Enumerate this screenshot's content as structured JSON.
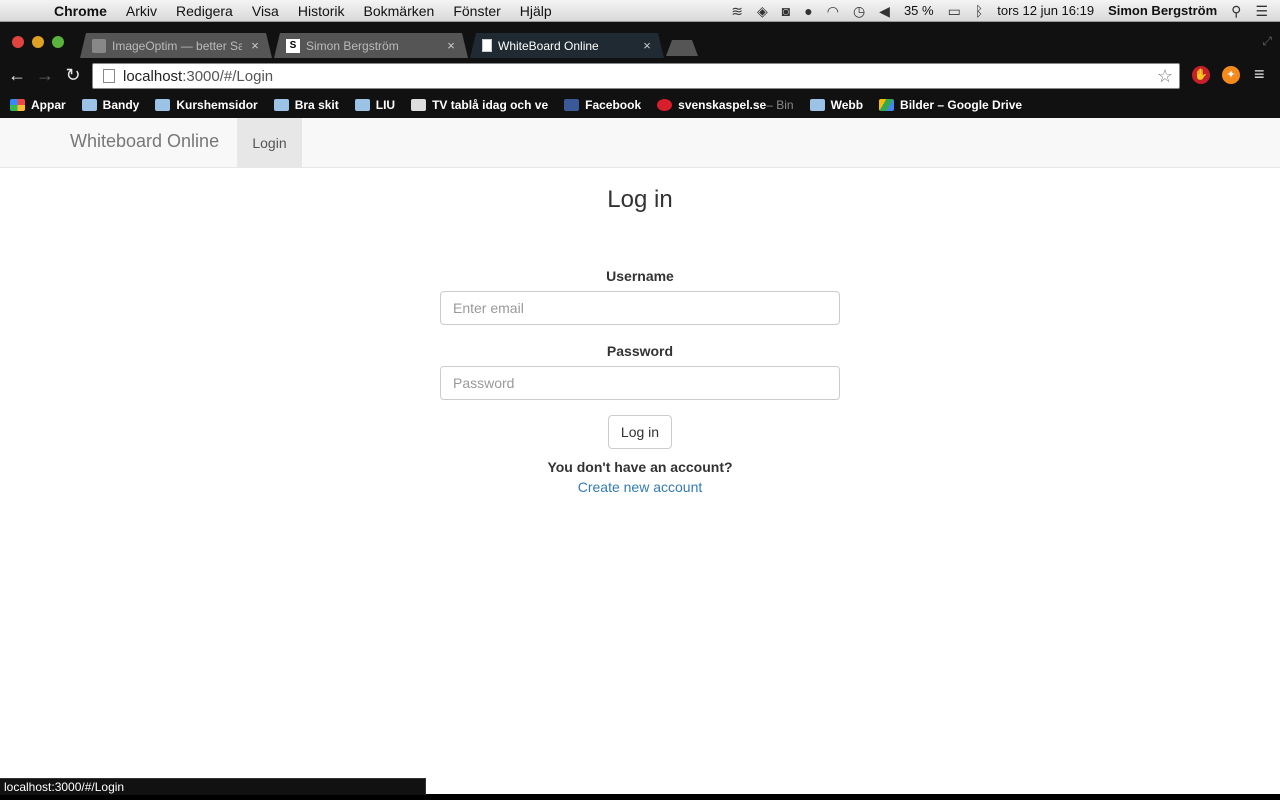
{
  "menubar": {
    "items": [
      "Chrome",
      "Arkiv",
      "Redigera",
      "Visa",
      "Historik",
      "Bokmärken",
      "Fönster",
      "Hjälp"
    ],
    "battery": "35 %",
    "datetime": "tors 12 jun  16:19",
    "user": "Simon Bergström"
  },
  "tabs": [
    {
      "title": "ImageOptim — better Save",
      "close": "×"
    },
    {
      "title": "Simon Bergström",
      "close": "×",
      "fav": "S"
    },
    {
      "title": "WhiteBoard Online",
      "close": "×"
    }
  ],
  "omnibox": {
    "host": "localhost",
    "path": ":3000/#/Login"
  },
  "bookmarks": [
    {
      "label": "Appar"
    },
    {
      "label": "Bandy"
    },
    {
      "label": "Kurshemsidor"
    },
    {
      "label": "Bra skit"
    },
    {
      "label": "LIU"
    },
    {
      "label": "TV tablå idag och ve"
    },
    {
      "label": "Facebook"
    },
    {
      "label": "svenskaspel.se",
      "suffix": " – Bin"
    },
    {
      "label": "Webb"
    },
    {
      "label": "Bilder – Google Drive"
    }
  ],
  "navbar": {
    "brand": "Whiteboard Online",
    "link": "Login"
  },
  "login": {
    "heading": "Log in",
    "username_label": "Username",
    "username_placeholder": "Enter email",
    "password_label": "Password",
    "password_placeholder": "Password",
    "submit": "Log in",
    "no_account": "You don't have an account?",
    "create_link": "Create new account"
  },
  "statusbar": {
    "url": "localhost:3000/#/Login"
  }
}
